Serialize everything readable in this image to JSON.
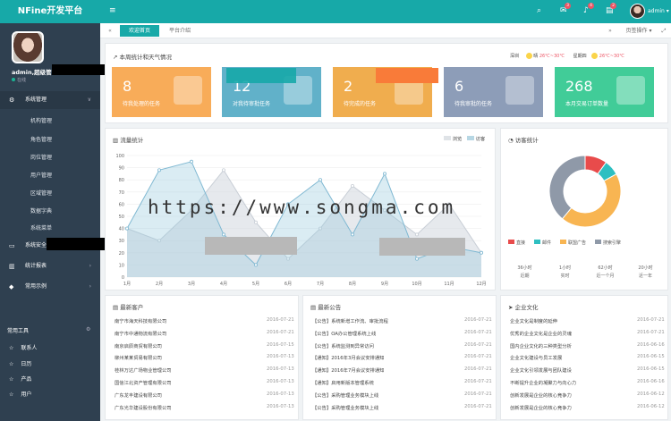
{
  "app_title": "NFine开发平台",
  "header": {
    "user": "admin",
    "badges": [
      "3",
      "4",
      "2"
    ]
  },
  "profile": {
    "name": "admin,超级管",
    "status": "在线"
  },
  "nav": {
    "system_mgmt": "系统管理",
    "sub_items": [
      "机构管理",
      "角色管理",
      "岗位管理",
      "用户管理",
      "区域管理",
      "数据字典",
      "系统菜单"
    ],
    "security": "系统安全",
    "stats": "统计报表",
    "common": "常用示例"
  },
  "tools": {
    "header": "常用工具",
    "items": [
      "联系人",
      "日历",
      "产品",
      "用户"
    ]
  },
  "tabs": {
    "home": "欢迎首页",
    "other": "平台介绍",
    "refresh": "刷新",
    "close_ops": "页签操作"
  },
  "welcome": {
    "title": "本周统计和天气情况",
    "weather_city": "深圳",
    "weather_today": "晴",
    "temp_today": "26℃~30℃",
    "label_tomorrow": "星期四",
    "temp_tomorrow": "26℃~30℃"
  },
  "cards": [
    {
      "num": "8",
      "label": "待我处理的任务",
      "color": "#f8ac59"
    },
    {
      "num": "12",
      "label": "对我待审批任务",
      "color": "#61b1c9"
    },
    {
      "num": "2",
      "label": "待完成的任务",
      "color": "#f0ad4e"
    },
    {
      "num": "6",
      "label": "待我审批的任务",
      "color": "#8d9db8"
    },
    {
      "num": "268",
      "label": "本月交易订单数量",
      "color": "#41cc98"
    }
  ],
  "chart_panel": {
    "title": "流量统计",
    "legend": [
      "浏览",
      "访客"
    ]
  },
  "chart_data": {
    "type": "area",
    "x": [
      "1月",
      "2月",
      "3月",
      "4月",
      "5月",
      "6月",
      "7月",
      "8月",
      "9月",
      "10月",
      "11月",
      "12月"
    ],
    "ylim": [
      0,
      100
    ],
    "yticks": [
      0,
      10,
      20,
      30,
      40,
      50,
      60,
      70,
      80,
      90,
      100
    ],
    "series": [
      {
        "name": "浏览",
        "values": [
          40,
          30,
          55,
          88,
          45,
          15,
          40,
          75,
          55,
          35,
          60,
          20
        ]
      },
      {
        "name": "访客",
        "values": [
          40,
          88,
          95,
          35,
          10,
          60,
          80,
          35,
          85,
          15,
          25,
          20
        ]
      }
    ],
    "pie_title": "访客统计",
    "pie": [
      {
        "name": "直接",
        "value": 10,
        "color": "#e84b4b"
      },
      {
        "name": "邮件",
        "value": 7,
        "color": "#2ebfc1"
      },
      {
        "name": "联盟广告",
        "value": 44,
        "color": "#f8b552"
      },
      {
        "name": "搜索引擎",
        "value": 39,
        "color": "#8f99a8"
      }
    ]
  },
  "time_stats": [
    [
      "36小时",
      "近期"
    ],
    [
      "1小时",
      "实时"
    ],
    [
      "62小时",
      "近一个月"
    ],
    [
      "20小时",
      "近一年"
    ]
  ],
  "news": {
    "title": "最新客户",
    "rows": [
      [
        "南宁市海天科技有限公司",
        "2016-07-21"
      ],
      [
        "南宁市中通物流有限公司",
        "2016-07-21"
      ],
      [
        "南京启辰商贸有限公司",
        "2016-07-15"
      ],
      [
        "柳州某某贸易有限公司",
        "2016-07-13"
      ],
      [
        "桂林万达广场物业管理公司",
        "2016-07-13"
      ],
      [
        "国信江北资产管理有限公司",
        "2016-07-13"
      ],
      [
        "广东龙丰建设有限公司",
        "2016-07-13"
      ],
      [
        "广东光华建设股份有限公司",
        "2016-07-13"
      ]
    ]
  },
  "notices": {
    "title": "最新公告",
    "rows": [
      [
        "【公告】系统新增工作流、审批流程",
        "2016-07-21"
      ],
      [
        "【公告】OA办公管理系统上线",
        "2016-07-21"
      ],
      [
        "【公告】系统监测到异常访问",
        "2016-07-21"
      ],
      [
        "【通知】2016年3月会议安排通知",
        "2016-07-21"
      ],
      [
        "【通知】2016年7月会议安排通知",
        "2016-07-21"
      ],
      [
        "【通知】启用新版本管理系统",
        "2016-07-21"
      ],
      [
        "【公告】采购管理业务模块上线",
        "2016-07-21"
      ],
      [
        "【公告】采购管理业务模块上线",
        "2016-07-21"
      ]
    ]
  },
  "culture": {
    "title": "企业文化",
    "rows": [
      [
        "企业文化是制度的延伸",
        "2016-07-21"
      ],
      [
        "优秀的企业文化是企业的灵魂",
        "2016-07-21"
      ],
      [
        "国内企业文化的三种类型分析",
        "2016-06-16"
      ],
      [
        "企业文化建设与员工发展",
        "2016-06-15"
      ],
      [
        "企业文化引领发展与团队建设",
        "2016-06-15"
      ],
      [
        "不断提升企业的凝聚力与向心力",
        "2016-06-16"
      ],
      [
        "创新发展是企业的核心竞争力",
        "2016-06-12"
      ],
      [
        "创新发展是企业的核心竞争力",
        "2016-06-12"
      ]
    ]
  }
}
